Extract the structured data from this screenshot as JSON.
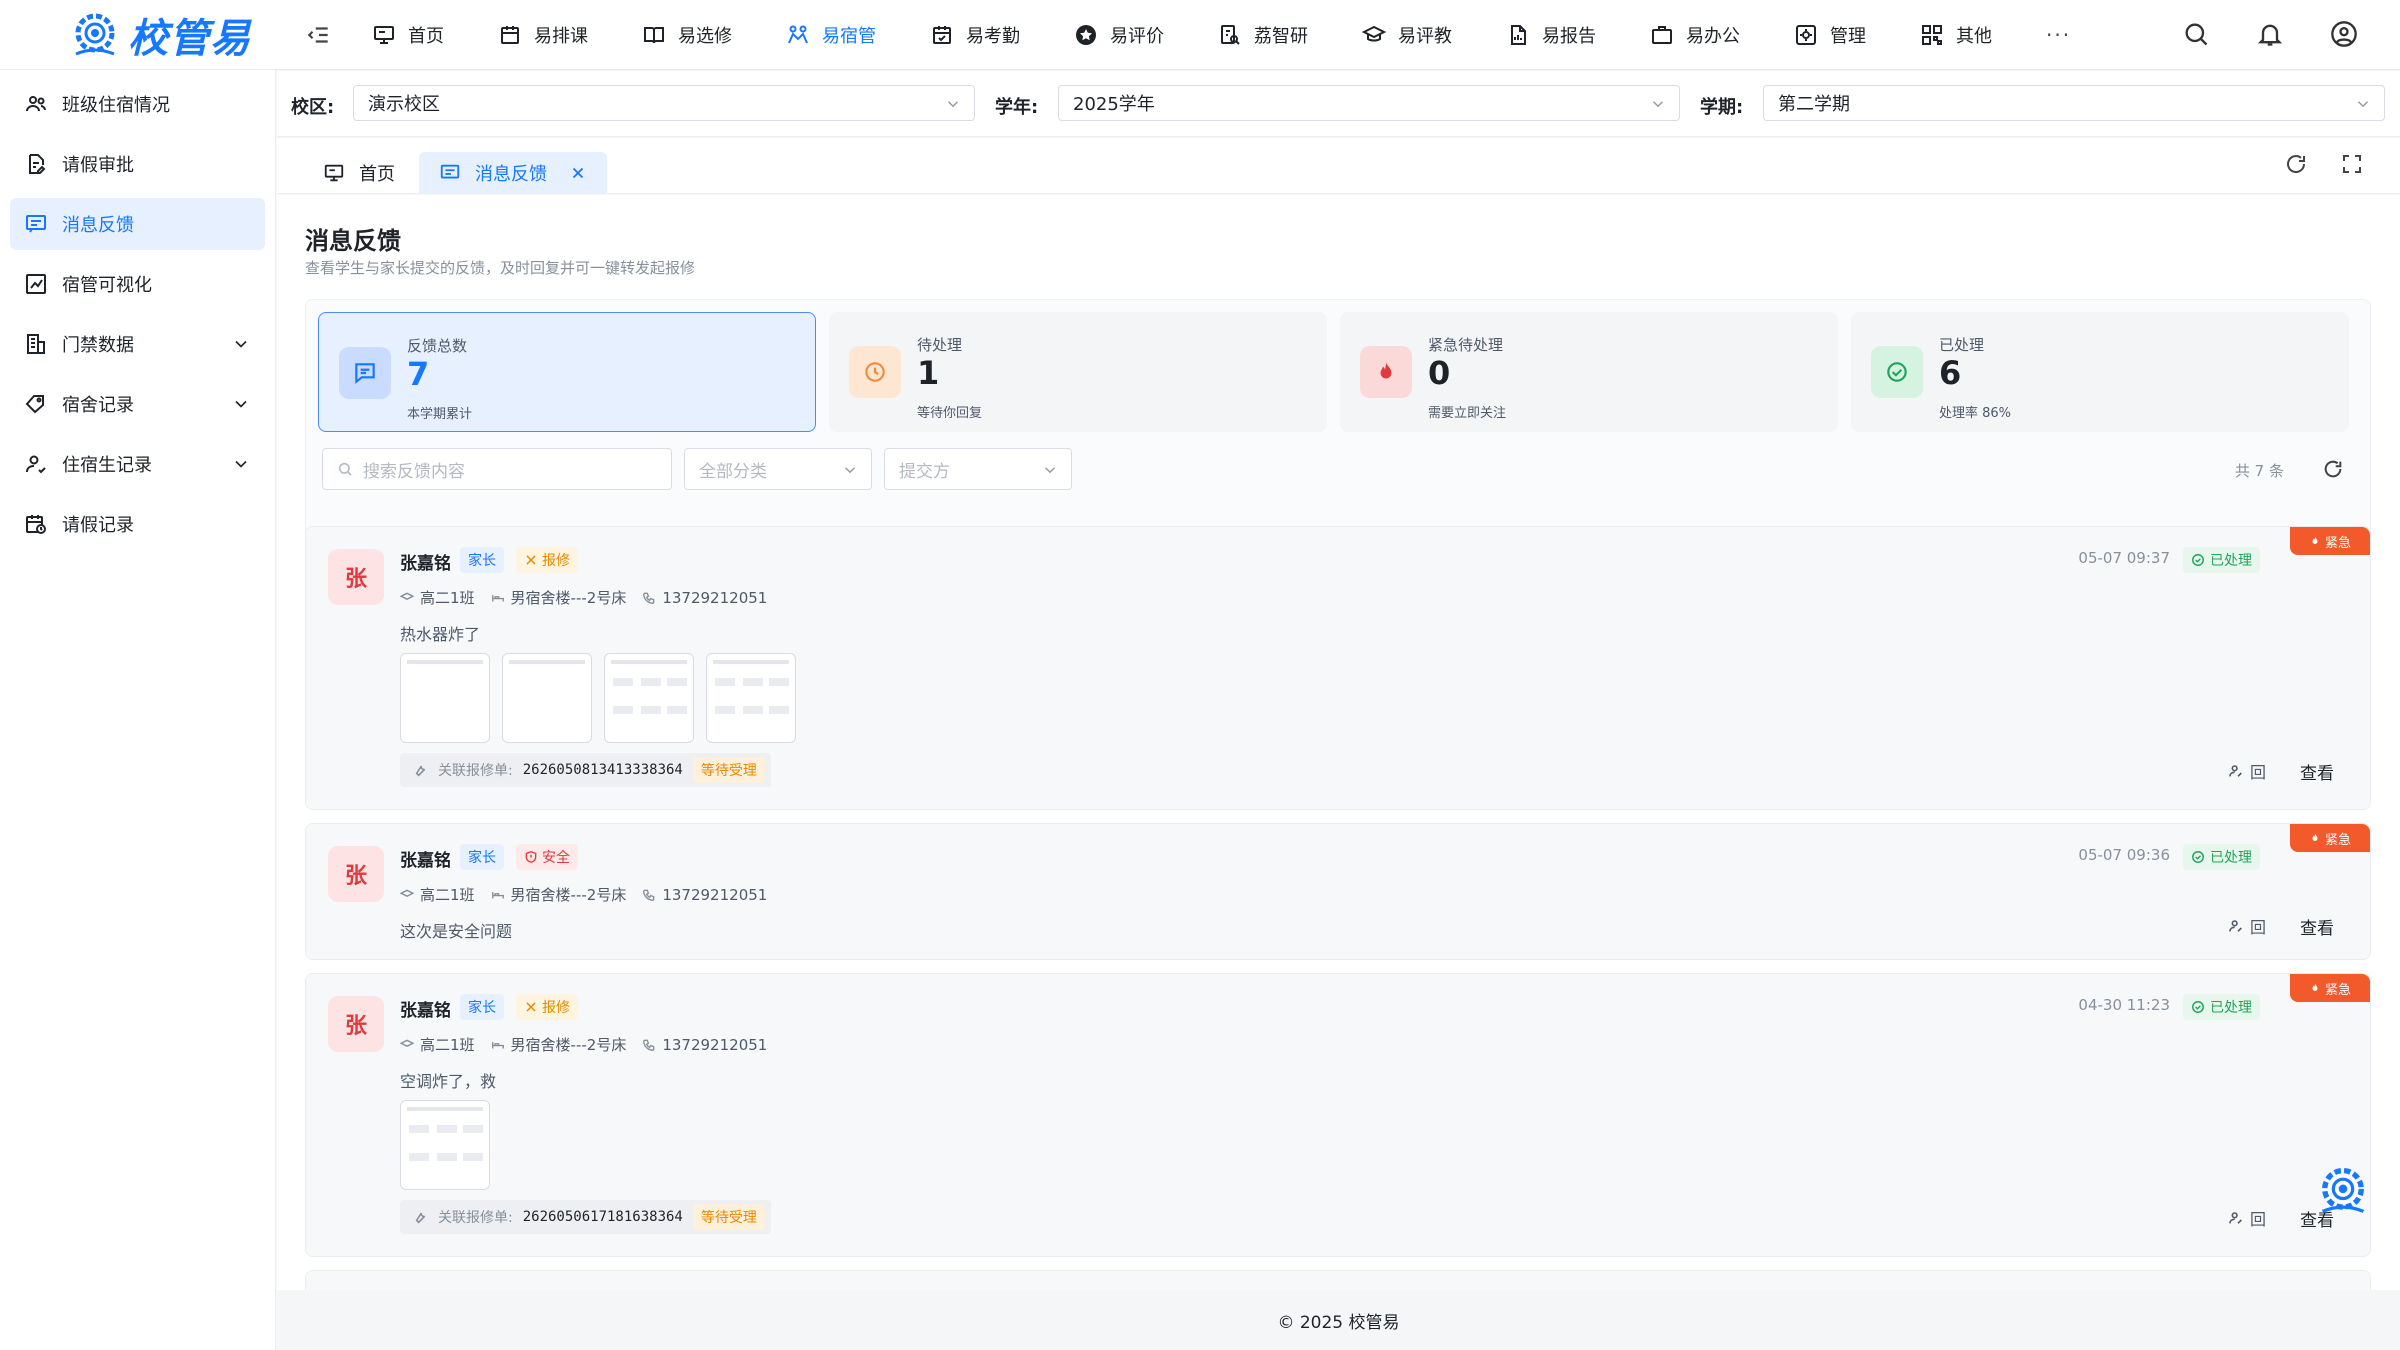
{
  "app": {
    "brand": "校管易",
    "colors": {
      "primary": "#1677ff",
      "urgent": "#f25a2c",
      "success": "#1fa55b",
      "warning": "#e58a00"
    }
  },
  "nav": {
    "items": [
      {
        "label": "首页",
        "icon": "monitor-icon"
      },
      {
        "label": "易排课",
        "icon": "calendar-icon"
      },
      {
        "label": "易选修",
        "icon": "book-icon"
      },
      {
        "label": "易宿管",
        "icon": "dorm-icon",
        "active": true
      },
      {
        "label": "易考勤",
        "icon": "calendar-check-icon"
      },
      {
        "label": "易评价",
        "icon": "star-icon"
      },
      {
        "label": "荔智研",
        "icon": "research-icon"
      },
      {
        "label": "易评教",
        "icon": "graduation-cap-icon"
      },
      {
        "label": "易报告",
        "icon": "report-icon"
      },
      {
        "label": "易办公",
        "icon": "briefcase-icon"
      },
      {
        "label": "管理",
        "icon": "settings-icon"
      },
      {
        "label": "其他",
        "icon": "grid-icon"
      }
    ],
    "more": "···"
  },
  "sidebar": {
    "items": [
      {
        "label": "班级住宿情况"
      },
      {
        "label": "请假审批"
      },
      {
        "label": "消息反馈",
        "active": true
      },
      {
        "label": "宿管可视化"
      },
      {
        "label": "门禁数据",
        "expandable": true
      },
      {
        "label": "宿舍记录",
        "expandable": true
      },
      {
        "label": "住宿生记录",
        "expandable": true
      },
      {
        "label": "请假记录"
      }
    ]
  },
  "filters": {
    "campus_label": "校区:",
    "campus_value": "演示校区",
    "year_label": "学年:",
    "year_value": "2025学年",
    "term_label": "学期:",
    "term_value": "第二学期"
  },
  "tabs": [
    {
      "label": "首页"
    },
    {
      "label": "消息反馈",
      "active": true
    }
  ],
  "page": {
    "title": "消息反馈",
    "subtitle": "查看学生与家长提交的反馈，及时回复并可一键转发起报修"
  },
  "stats": [
    {
      "label": "反馈总数",
      "value": "7",
      "hint": "本学期累计"
    },
    {
      "label": "待处理",
      "value": "1",
      "hint": "等待你回复"
    },
    {
      "label": "紧急待处理",
      "value": "0",
      "hint": "需要立即关注"
    },
    {
      "label": "已处理",
      "value": "6",
      "hint": "处理率 86%"
    }
  ],
  "toolbar": {
    "search_placeholder": "搜索反馈内容",
    "category_placeholder": "全部分类",
    "submitter_placeholder": "提交方",
    "total": "共 7 条"
  },
  "feedback": [
    {
      "avatar": "张",
      "name": "张嘉铭",
      "role": "家长",
      "category": "报修",
      "class": "高二1班",
      "dorm": "男宿舍楼---2号床",
      "phone": "13729212051",
      "content": "热水器炸了",
      "time": "05-07 09:37",
      "status": "已处理",
      "urgent": "紧急",
      "repair_label": "关联报修单:",
      "repair_no": "2626050813413338364",
      "repair_status": "等待受理",
      "reply": "回",
      "view": "查看"
    },
    {
      "avatar": "张",
      "name": "张嘉铭",
      "role": "家长",
      "category": "安全",
      "class": "高二1班",
      "dorm": "男宿舍楼---2号床",
      "phone": "13729212051",
      "content": "这次是安全问题",
      "time": "05-07 09:36",
      "status": "已处理",
      "urgent": "紧急",
      "reply": "回",
      "view": "查看"
    },
    {
      "avatar": "张",
      "name": "张嘉铭",
      "role": "家长",
      "category": "报修",
      "class": "高二1班",
      "dorm": "男宿舍楼---2号床",
      "phone": "13729212051",
      "content": "空调炸了，救",
      "time": "04-30 11:23",
      "status": "已处理",
      "urgent": "紧急",
      "repair_label": "关联报修单:",
      "repair_no": "2626050617181638364",
      "repair_status": "等待受理",
      "reply": "回",
      "view": "查看"
    }
  ],
  "footer": {
    "copyright": "© 2025 校管易"
  }
}
